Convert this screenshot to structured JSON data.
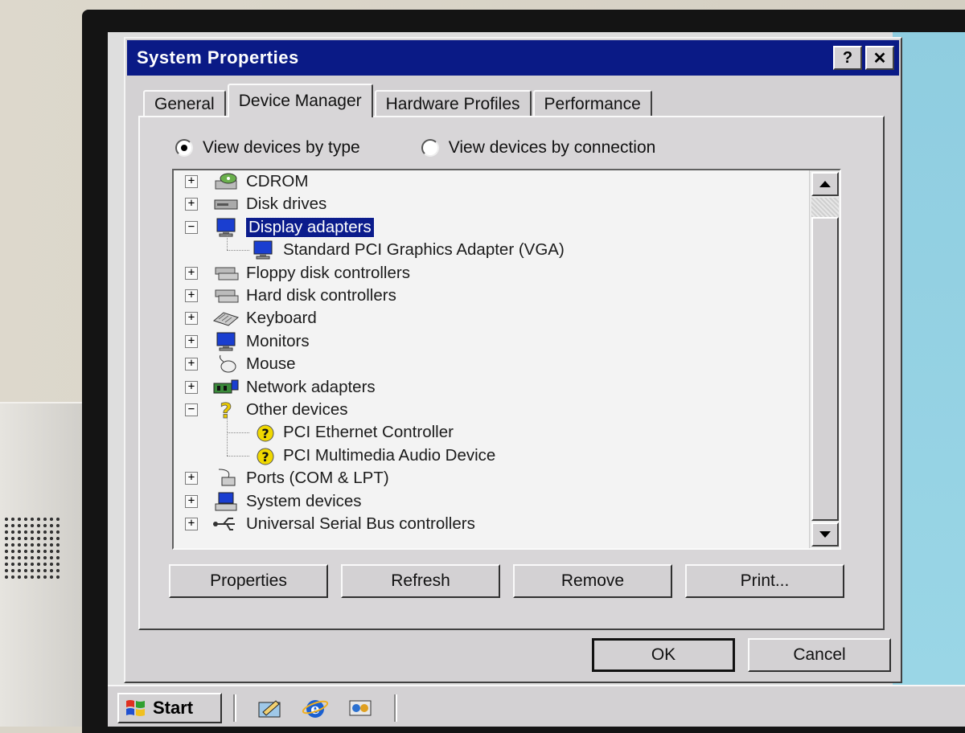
{
  "window": {
    "title": "System Properties",
    "help_btn": "?",
    "close_btn": "✕"
  },
  "tabs": [
    {
      "label": "General"
    },
    {
      "label": "Device Manager",
      "active": true
    },
    {
      "label": "Hardware Profiles"
    },
    {
      "label": "Performance"
    }
  ],
  "view": {
    "by_type": "View devices by type",
    "by_connection": "View devices by connection",
    "selected": "by_type"
  },
  "devices": [
    {
      "label": "CDROM",
      "icon": "cdrom-icon",
      "expander": "+"
    },
    {
      "label": "Disk drives",
      "icon": "disk-drive-icon",
      "expander": "+"
    },
    {
      "label": "Display adapters",
      "icon": "monitor-icon",
      "expander": "−",
      "selected": true
    },
    {
      "label": "Standard PCI Graphics Adapter (VGA)",
      "icon": "monitor-icon",
      "child": true
    },
    {
      "label": "Floppy disk controllers",
      "icon": "controller-icon",
      "expander": "+"
    },
    {
      "label": "Hard disk controllers",
      "icon": "controller-icon",
      "expander": "+"
    },
    {
      "label": "Keyboard",
      "icon": "keyboard-icon",
      "expander": "+"
    },
    {
      "label": "Monitors",
      "icon": "monitor-icon",
      "expander": "+"
    },
    {
      "label": "Mouse",
      "icon": "mouse-icon",
      "expander": "+"
    },
    {
      "label": "Network adapters",
      "icon": "network-icon",
      "expander": "+"
    },
    {
      "label": "Other devices",
      "icon": "question-icon",
      "expander": "−"
    },
    {
      "label": "PCI Ethernet Controller",
      "icon": "unknown-device-icon",
      "child": true
    },
    {
      "label": "PCI Multimedia Audio Device",
      "icon": "unknown-device-icon",
      "child": true
    },
    {
      "label": "Ports (COM & LPT)",
      "icon": "port-icon",
      "expander": "+"
    },
    {
      "label": "System devices",
      "icon": "computer-icon",
      "expander": "+"
    },
    {
      "label": "Universal Serial Bus controllers",
      "icon": "usb-icon",
      "expander": "+"
    }
  ],
  "buttons": {
    "properties": "Properties",
    "refresh": "Refresh",
    "remove": "Remove",
    "print": "Print...",
    "ok": "OK",
    "cancel": "Cancel"
  },
  "taskbar": {
    "start": "Start",
    "quick_icons": [
      "show-desktop-icon",
      "internet-explorer-icon",
      "channels-icon"
    ]
  },
  "colors": {
    "titlebar": "#0a1a86",
    "selection": "#0b1c8c",
    "desktop": "#8fcde0"
  }
}
